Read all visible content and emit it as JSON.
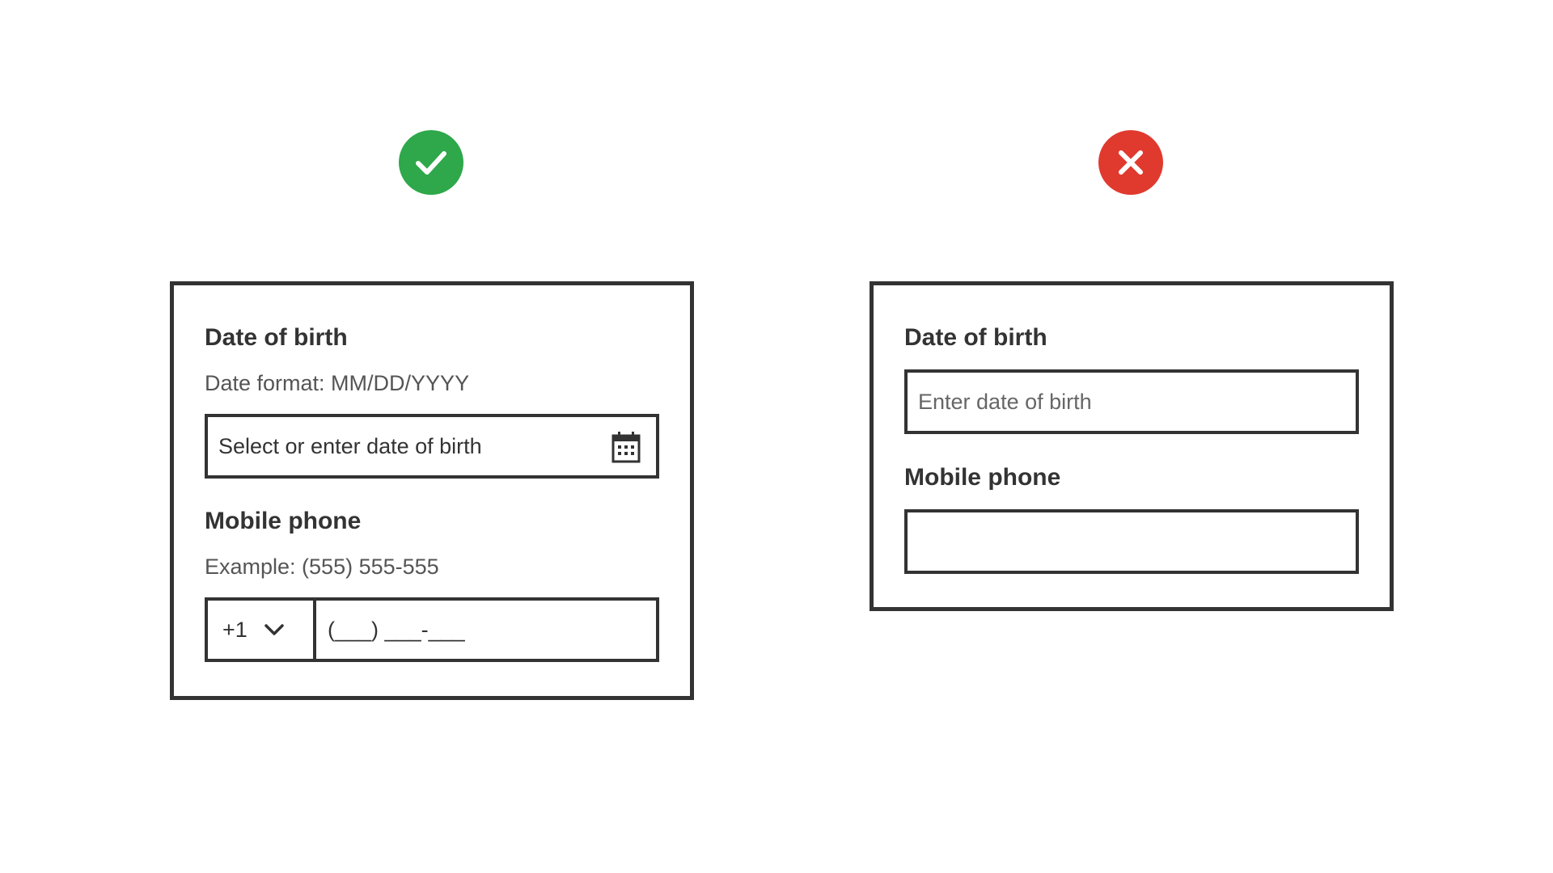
{
  "colors": {
    "good_badge": "#2ea84a",
    "bad_badge": "#e03a2f",
    "border": "#333333"
  },
  "good_example": {
    "badge_icon": "checkmark-icon",
    "date_field": {
      "label": "Date of birth",
      "hint": "Date format: MM/DD/YYYY",
      "value": "Select or enter date of birth",
      "icon": "calendar-icon"
    },
    "phone_field": {
      "label": "Mobile phone",
      "hint": "Example: (555) 555-555",
      "country_code": "+1",
      "country_icon": "chevron-down-icon",
      "mask": "(___) ___-___"
    }
  },
  "bad_example": {
    "badge_icon": "close-icon",
    "date_field": {
      "label": "Date of birth",
      "placeholder": "Enter date of birth"
    },
    "phone_field": {
      "label": "Mobile phone",
      "value": ""
    }
  }
}
